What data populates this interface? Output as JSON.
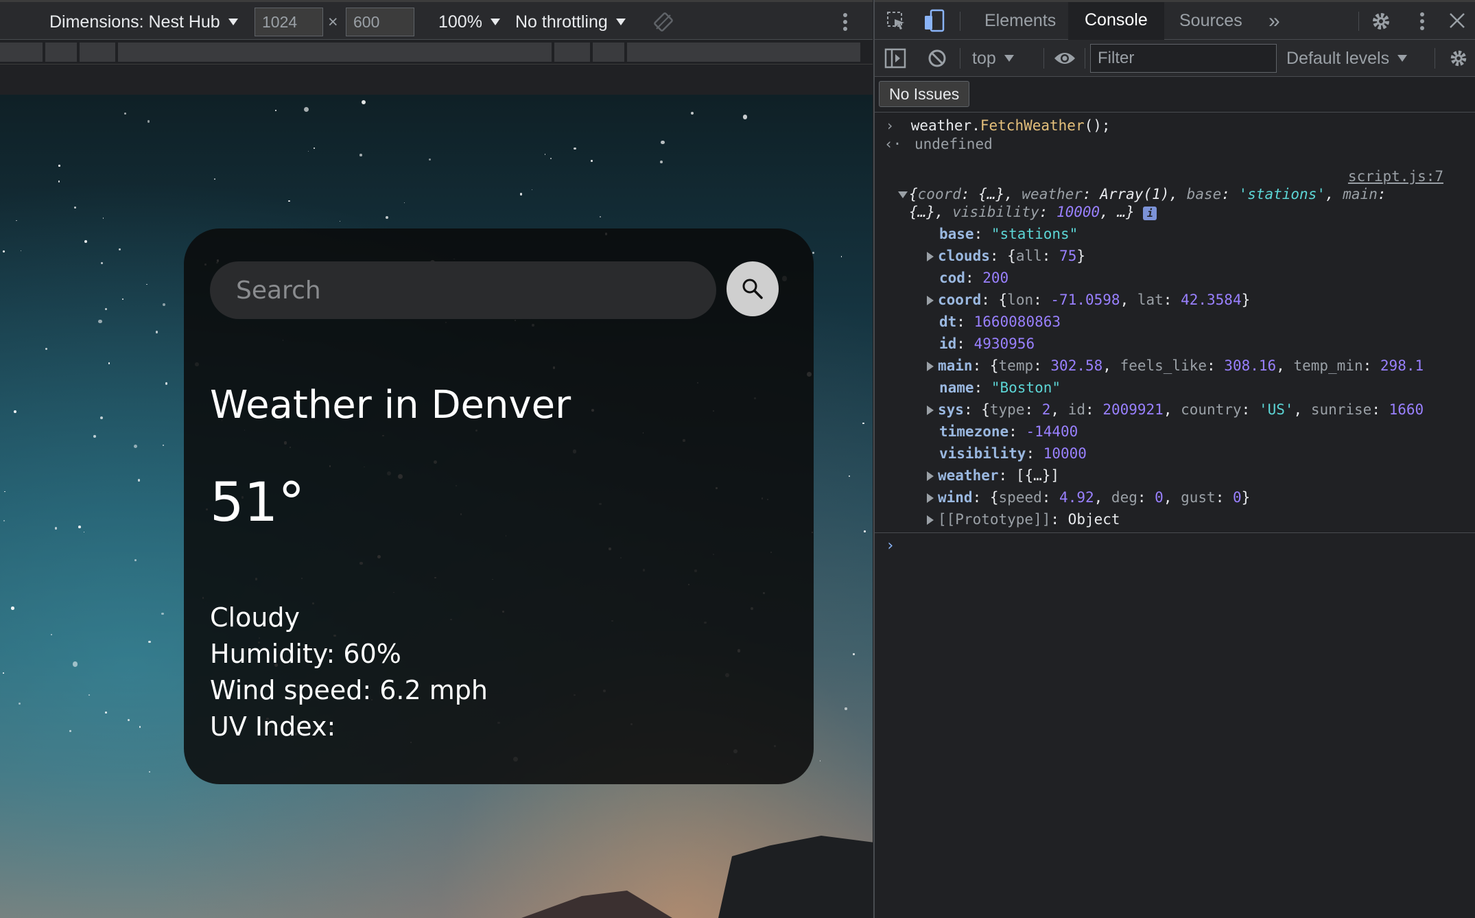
{
  "device_toolbar": {
    "dimensions_label": "Dimensions: Nest Hub",
    "width_value": "1024",
    "height_value": "600",
    "times_symbol": "×",
    "zoom_label": "100%",
    "throttling_label": "No throttling"
  },
  "weather_app": {
    "search_placeholder": "Search",
    "city_heading": "Weather in Denver",
    "temperature": "51°",
    "description": "Cloudy",
    "humidity": "Humidity: 60%",
    "wind_speed": "Wind speed: 6.2 mph",
    "uv_index": "UV Index:"
  },
  "devtools": {
    "tabs": [
      "Elements",
      "Console",
      "Sources"
    ],
    "active_tab": "Console",
    "more_tabs": "»",
    "context_label": "top",
    "filter_placeholder": "Filter",
    "levels_label": "Default levels",
    "issues_label": "No Issues"
  },
  "console": {
    "input_obj": "weather",
    "input_dot": ".",
    "input_fn": "FetchWeather",
    "input_end": "();",
    "result_text": "undefined",
    "source_link": "script.js:7",
    "summary": {
      "k1": "coord",
      "v1": "{…}",
      "k2": "weather",
      "v2": "Array(1)",
      "k3": "base",
      "v3": "'stations'",
      "k4": "main",
      "v4": "{…}",
      "k5": "visibility",
      "v5": "10000",
      "tail": "…}"
    },
    "info_badge": "i",
    "properties": {
      "base": {
        "key": "base",
        "value": "\"stations\""
      },
      "clouds": {
        "key": "clouds",
        "open": "{",
        "k1": "all",
        "v1": "75",
        "close": "}"
      },
      "cod": {
        "key": "cod",
        "value": "200"
      },
      "coord": {
        "key": "coord",
        "open": "{",
        "k1": "lon",
        "v1": "-71.0598",
        "k2": "lat",
        "v2": "42.3584",
        "close": "}"
      },
      "dt": {
        "key": "dt",
        "value": "1660080863"
      },
      "id": {
        "key": "id",
        "value": "4930956"
      },
      "main": {
        "key": "main",
        "open": "{",
        "k1": "temp",
        "v1": "302.58",
        "k2": "feels_like",
        "v2": "308.16",
        "k3": "temp_min",
        "v3": "298.1"
      },
      "name": {
        "key": "name",
        "value": "\"Boston\""
      },
      "sys": {
        "key": "sys",
        "open": "{",
        "k1": "type",
        "v1": "2",
        "k2": "id",
        "v2": "2009921",
        "k3": "country",
        "v3": "'US'",
        "k4": "sunrise",
        "v4": "1660"
      },
      "timezone": {
        "key": "timezone",
        "value": "-14400"
      },
      "visibility": {
        "key": "visibility",
        "value": "10000"
      },
      "weather": {
        "key": "weather",
        "value": "[{…}]"
      },
      "wind": {
        "key": "wind",
        "open": "{",
        "k1": "speed",
        "v1": "4.92",
        "k2": "deg",
        "v2": "0",
        "k3": "gust",
        "v3": "0",
        "close": "}"
      },
      "prototype": {
        "key": "[[Prototype]]",
        "value": "Object"
      }
    }
  }
}
